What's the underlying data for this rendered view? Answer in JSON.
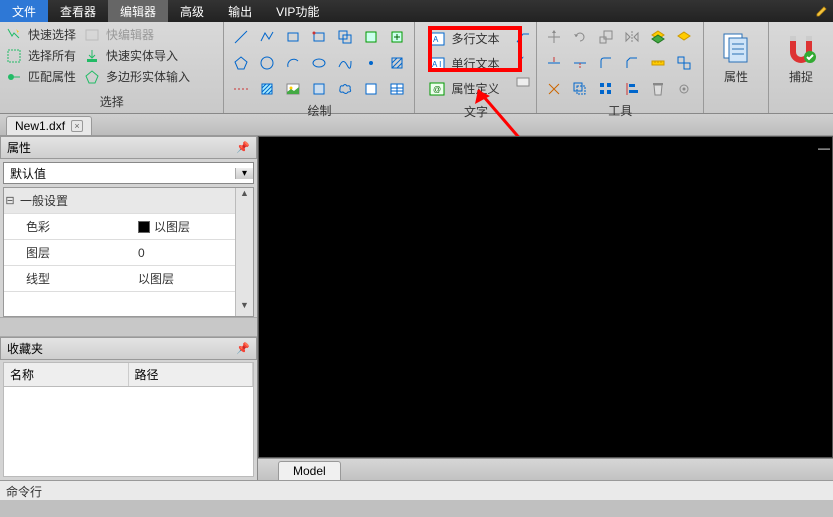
{
  "menubar": {
    "tabs": [
      "文件",
      "查看器",
      "编辑器",
      "高级",
      "输出",
      "VIP功能"
    ],
    "active_index": 2
  },
  "ribbon": {
    "select": {
      "label": "选择",
      "items": [
        {
          "label": "快速选择",
          "disabled": false
        },
        {
          "label": "选择所有",
          "disabled": false
        },
        {
          "label": "匹配属性",
          "disabled": false
        }
      ],
      "items2": [
        {
          "label": "快编辑器",
          "disabled": true
        },
        {
          "label": "快速实体导入",
          "disabled": false
        },
        {
          "label": "多边形实体输入",
          "disabled": false
        }
      ]
    },
    "draw": {
      "label": "绘制"
    },
    "text": {
      "label": "文字",
      "items": [
        "多行文本",
        "单行文本",
        "属性定义"
      ]
    },
    "tools": {
      "label": "工具"
    },
    "props": {
      "label": "属性"
    },
    "snap": {
      "label": "捕捉"
    }
  },
  "doc_tab": {
    "name": "New1.dxf"
  },
  "panels": {
    "props_title": "属性",
    "default_value": "默认值",
    "section": "一般设置",
    "rows": [
      {
        "k": "色彩",
        "v": "以图层",
        "swatch": true
      },
      {
        "k": "图层",
        "v": "0"
      },
      {
        "k": "线型",
        "v": "以图层"
      }
    ],
    "fav_title": "收藏夹",
    "fav_cols": [
      "名称",
      "路径"
    ]
  },
  "model_tab": "Model",
  "cmdline": "命令行"
}
